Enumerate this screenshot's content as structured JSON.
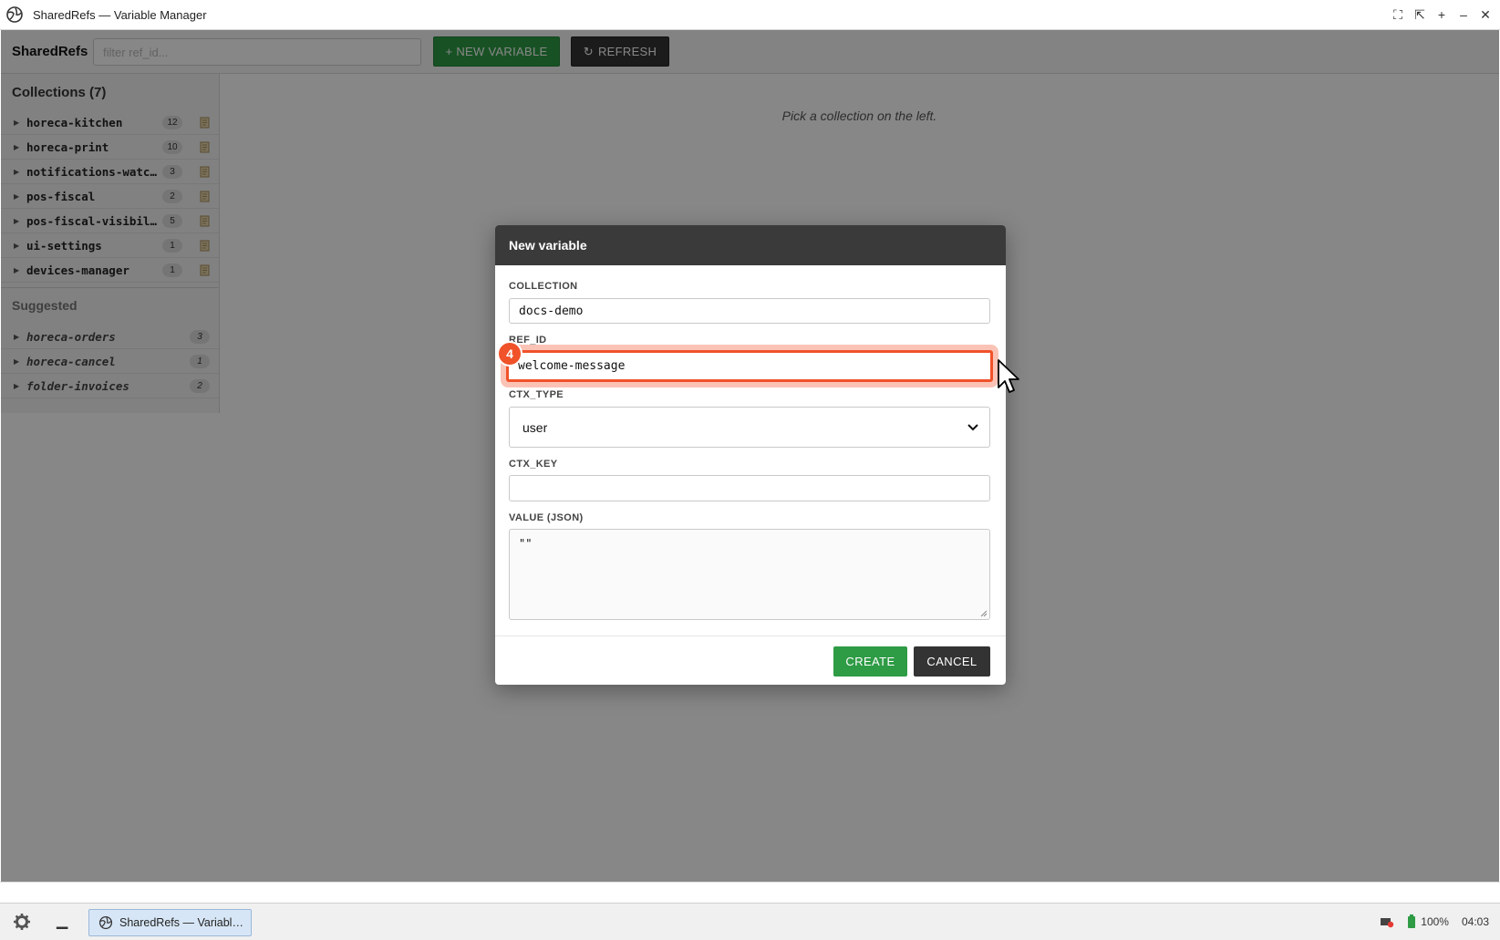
{
  "window": {
    "title": "SharedRefs — Variable Manager",
    "controls": [
      "fullscreen-icon",
      "restore-icon",
      "maximize-icon",
      "minimize-icon",
      "close-icon"
    ]
  },
  "toolbar": {
    "brand": "SharedRefs",
    "filter_placeholder": "filter ref_id...",
    "new_variable_label": "+ NEW VARIABLE",
    "refresh_label": "REFRESH"
  },
  "sidebar": {
    "collections_heading": "Collections (7)",
    "collections": [
      {
        "name": "horeca-kitchen",
        "count": "12"
      },
      {
        "name": "horeca-print",
        "count": "10"
      },
      {
        "name": "notifications-watch…",
        "count": "3"
      },
      {
        "name": "pos-fiscal",
        "count": "2"
      },
      {
        "name": "pos-fiscal-visibili…",
        "count": "5"
      },
      {
        "name": "ui-settings",
        "count": "1"
      },
      {
        "name": "devices-manager",
        "count": "1"
      }
    ],
    "suggested_heading": "Suggested",
    "suggested": [
      {
        "name": "horeca-orders",
        "count": "3"
      },
      {
        "name": "horeca-cancel",
        "count": "1"
      },
      {
        "name": "folder-invoices",
        "count": "2"
      }
    ]
  },
  "main": {
    "hint": "Pick a collection on the left."
  },
  "modal": {
    "title": "New variable",
    "collection_label": "COLLECTION",
    "collection_value": "docs-demo",
    "ref_id_label": "REF_ID",
    "ref_id_value": "welcome-message",
    "ctx_type_label": "CTX_TYPE",
    "ctx_type_value": "user",
    "ctx_key_label": "CTX_KEY",
    "ctx_key_value": "",
    "value_label": "VALUE (JSON)",
    "value_value": "\"\"",
    "create_label": "CREATE",
    "cancel_label": "CANCEL"
  },
  "annotation": {
    "step": "4"
  },
  "taskbar": {
    "task_label": "SharedRefs — Variabl…",
    "battery": "100%",
    "clock": "04:03"
  },
  "colors": {
    "accent_green": "#2e9b45",
    "dark_button": "#333333",
    "focus_orange": "#f0522a"
  }
}
